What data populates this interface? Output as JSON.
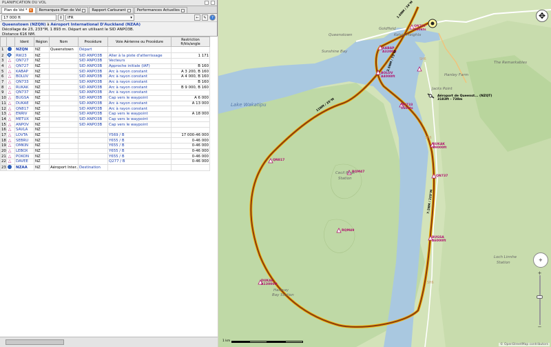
{
  "window": {
    "title": "PLANIFICATION DU VOL"
  },
  "tabs": [
    {
      "label": "Plan de Vol *"
    },
    {
      "label": "Remarques Plan de Vol"
    },
    {
      "label": "Rapport Carburant"
    },
    {
      "label": "Performances Actuelles"
    }
  ],
  "toolbar": {
    "altitude": "17 000 ft",
    "rules": "IFR"
  },
  "summary": {
    "origin": "Queenstown (NZQN)",
    "to_word": "à",
    "destination": "Aéroport International D'Auckland (NZAA)",
    "line2": "Décollage de 23, 233°M, 1 893 m. Départ en utilisant le SID ANPO3B.",
    "line3": "Distance 616 NM."
  },
  "table": {
    "headers": [
      "",
      "Ident",
      "Région",
      "Nom",
      "Procédure",
      "Voie Aérienne ou Procédure",
      "Restriction ft/kts/angle"
    ],
    "rows": [
      {
        "n": "1",
        "icon": "ap",
        "ident": "NZQN",
        "region": "NZ",
        "name": "Queenstown",
        "proc": "Départ",
        "airway": "",
        "restr": ""
      },
      {
        "n": "2",
        "icon": "sq",
        "ident": "RW23",
        "region": "NZ",
        "name": "",
        "proc": "SID ANPO3B",
        "airway": "Aller à la piste d'atterrissage",
        "restr": "1 171"
      },
      {
        "n": "3",
        "icon": "tri",
        "ident": "QN727",
        "region": "NZ",
        "name": "",
        "proc": "SID ANPO3B",
        "airway": "Vecteurs",
        "restr": ""
      },
      {
        "n": "4",
        "icon": "tri",
        "ident": "QN727",
        "region": "NZ",
        "name": "",
        "proc": "SID ANPO3B",
        "airway": "Approche initiale (IAF)",
        "restr": "B 160"
      },
      {
        "n": "5",
        "icon": "tri",
        "ident": "KABAP",
        "region": "NZ",
        "name": "",
        "proc": "SID ANPO3B",
        "airway": "Arc à rayon constant",
        "restr": "A 3 200, B 160"
      },
      {
        "n": "6",
        "icon": "tri",
        "ident": "BOLUV",
        "region": "NZ",
        "name": "",
        "proc": "SID ANPO3B",
        "airway": "Arc à rayon constant",
        "restr": "A 4 000, B 160"
      },
      {
        "n": "7",
        "icon": "tri",
        "ident": "QN733",
        "region": "NZ",
        "name": "",
        "proc": "SID ANPO3B",
        "airway": "Arc à rayon constant",
        "restr": "B 160"
      },
      {
        "n": "8",
        "icon": "tri",
        "ident": "RUKAK",
        "region": "NZ",
        "name": "",
        "proc": "SID ANPO3B",
        "airway": "Arc à rayon constant",
        "restr": "B 9 000, B 160"
      },
      {
        "n": "9",
        "icon": "tri",
        "ident": "QN737",
        "region": "NZ",
        "name": "",
        "proc": "SID ANPO3B",
        "airway": "Arc à rayon constant",
        "restr": ""
      },
      {
        "n": "10",
        "icon": "tri",
        "ident": "BUGSA",
        "region": "NZ",
        "name": "",
        "proc": "SID ANPO3B",
        "airway": "Cap vers le waypoint",
        "restr": "A 6 000"
      },
      {
        "n": "11",
        "icon": "tri",
        "ident": "DUKAE",
        "region": "NZ",
        "name": "",
        "proc": "SID ANPO3B",
        "airway": "Arc à rayon constant",
        "restr": "A 13 000"
      },
      {
        "n": "12",
        "icon": "tri",
        "ident": "QN817",
        "region": "NZ",
        "name": "",
        "proc": "SID ANPO3B",
        "airway": "Arc à rayon constant",
        "restr": ""
      },
      {
        "n": "13",
        "icon": "tri",
        "ident": "ENRIV",
        "region": "NZ",
        "name": "",
        "proc": "SID ANPO3B",
        "airway": "Cap vers le waypoint",
        "restr": "A 18 000"
      },
      {
        "n": "14",
        "icon": "tri",
        "ident": "METUX",
        "region": "NZ",
        "name": "",
        "proc": "SID ANPO3B",
        "airway": "Cap vers le waypoint",
        "restr": ""
      },
      {
        "n": "15",
        "icon": "tri",
        "ident": "ANPOV",
        "region": "NZ",
        "name": "",
        "proc": "SID ANPO3B",
        "airway": "Cap vers le waypoint",
        "restr": ""
      },
      {
        "n": "16",
        "icon": "tri",
        "ident": "SAVLA",
        "region": "NZ",
        "name": "",
        "proc": "",
        "airway": "",
        "restr": ""
      },
      {
        "n": "17",
        "icon": "tri",
        "ident": "LOVTA",
        "region": "NZ",
        "name": "",
        "proc": "",
        "airway": "Y569 / B",
        "restr": "17 000-46 000"
      },
      {
        "n": "18",
        "icon": "tri",
        "ident": "SEBRU",
        "region": "NZ",
        "name": "",
        "proc": "",
        "airway": "Y655 / B",
        "restr": "0-46 000"
      },
      {
        "n": "19",
        "icon": "tri",
        "ident": "OMKIN",
        "region": "NZ",
        "name": "",
        "proc": "",
        "airway": "Y655 / B",
        "restr": "0-46 000"
      },
      {
        "n": "20",
        "icon": "tri",
        "ident": "LEBOX",
        "region": "NZ",
        "name": "",
        "proc": "",
        "airway": "Y655 / B",
        "restr": "0-46 000"
      },
      {
        "n": "21",
        "icon": "tri",
        "ident": "POKON",
        "region": "NZ",
        "name": "",
        "proc": "",
        "airway": "Y655 / B",
        "restr": "0-46 000"
      },
      {
        "n": "22",
        "icon": "tri",
        "ident": "DAVEE",
        "region": "NZ",
        "name": "",
        "proc": "",
        "airway": "Q277 / B",
        "restr": "0-46 000"
      },
      {
        "n": "23",
        "icon": "ap",
        "ident": "NZAA",
        "region": "NZ",
        "name": "Aéroport Inter...",
        "proc": "Destination",
        "airway": "",
        "restr": ""
      }
    ]
  },
  "map": {
    "place_labels": {
      "queenstown": "Queenstown",
      "sunshine": "Sunshine Bay",
      "lake": "Lake Wakatipu",
      "cecil1": "Cecil Peak",
      "cecil2": "Station",
      "halfway1": "Halfway",
      "halfway2": "Bay Station",
      "loch1": "Loch Linnhe",
      "loch2": "Station",
      "goldfield": "Goldfield",
      "frankton": "Kelvin Heights",
      "remarkables": "The Remarkables",
      "jacks": "Jacks Point",
      "hanley": "Hanley Farm",
      "airport_name": "Aéroport de Queenst... (NZQT)",
      "airport_info": "3183ft - 738m"
    },
    "waypoints": [
      {
        "id": "kabap",
        "name": "KABAP",
        "info": "A3200ft"
      },
      {
        "id": "boluv",
        "name": "BOLUV",
        "info": "A4000ft"
      },
      {
        "id": "qn733",
        "name": "QN733",
        "info": "160kts"
      },
      {
        "id": "rukak",
        "name": "RUKAK",
        "info": "B9000ft"
      },
      {
        "id": "qn737",
        "name": "QN737",
        "info": ""
      },
      {
        "id": "bugsa",
        "name": "BUGSA",
        "info": "A6000ft"
      },
      {
        "id": "dukae",
        "name": "DUKAE",
        "info": "A13000ft"
      },
      {
        "id": "qn817",
        "name": "QN817",
        "info": ""
      },
      {
        "id": "rqm47",
        "name": "RQM47",
        "info": ""
      },
      {
        "id": "rqm49",
        "name": "RQM49",
        "info": ""
      },
      {
        "id": "qn727",
        "name": "QN727",
        "info": "160kts"
      }
    ],
    "leg_labels": {
      "leg1": "11NM / 35°M",
      "leg2": "7.2NM / 229°M",
      "leg3": "1.6NM / 34°M",
      "leg4": "2.5NM / 73°M"
    },
    "sh_markers": [
      "SH6",
      "SH6",
      "SH6"
    ],
    "scale": "1 km",
    "credit": "© OpenStreetMap contributors",
    "colors": {
      "lake": "#a9c8e0",
      "route": "#8a3a12",
      "route_outline": "#f0b000",
      "land": "#cfe0b4"
    }
  }
}
